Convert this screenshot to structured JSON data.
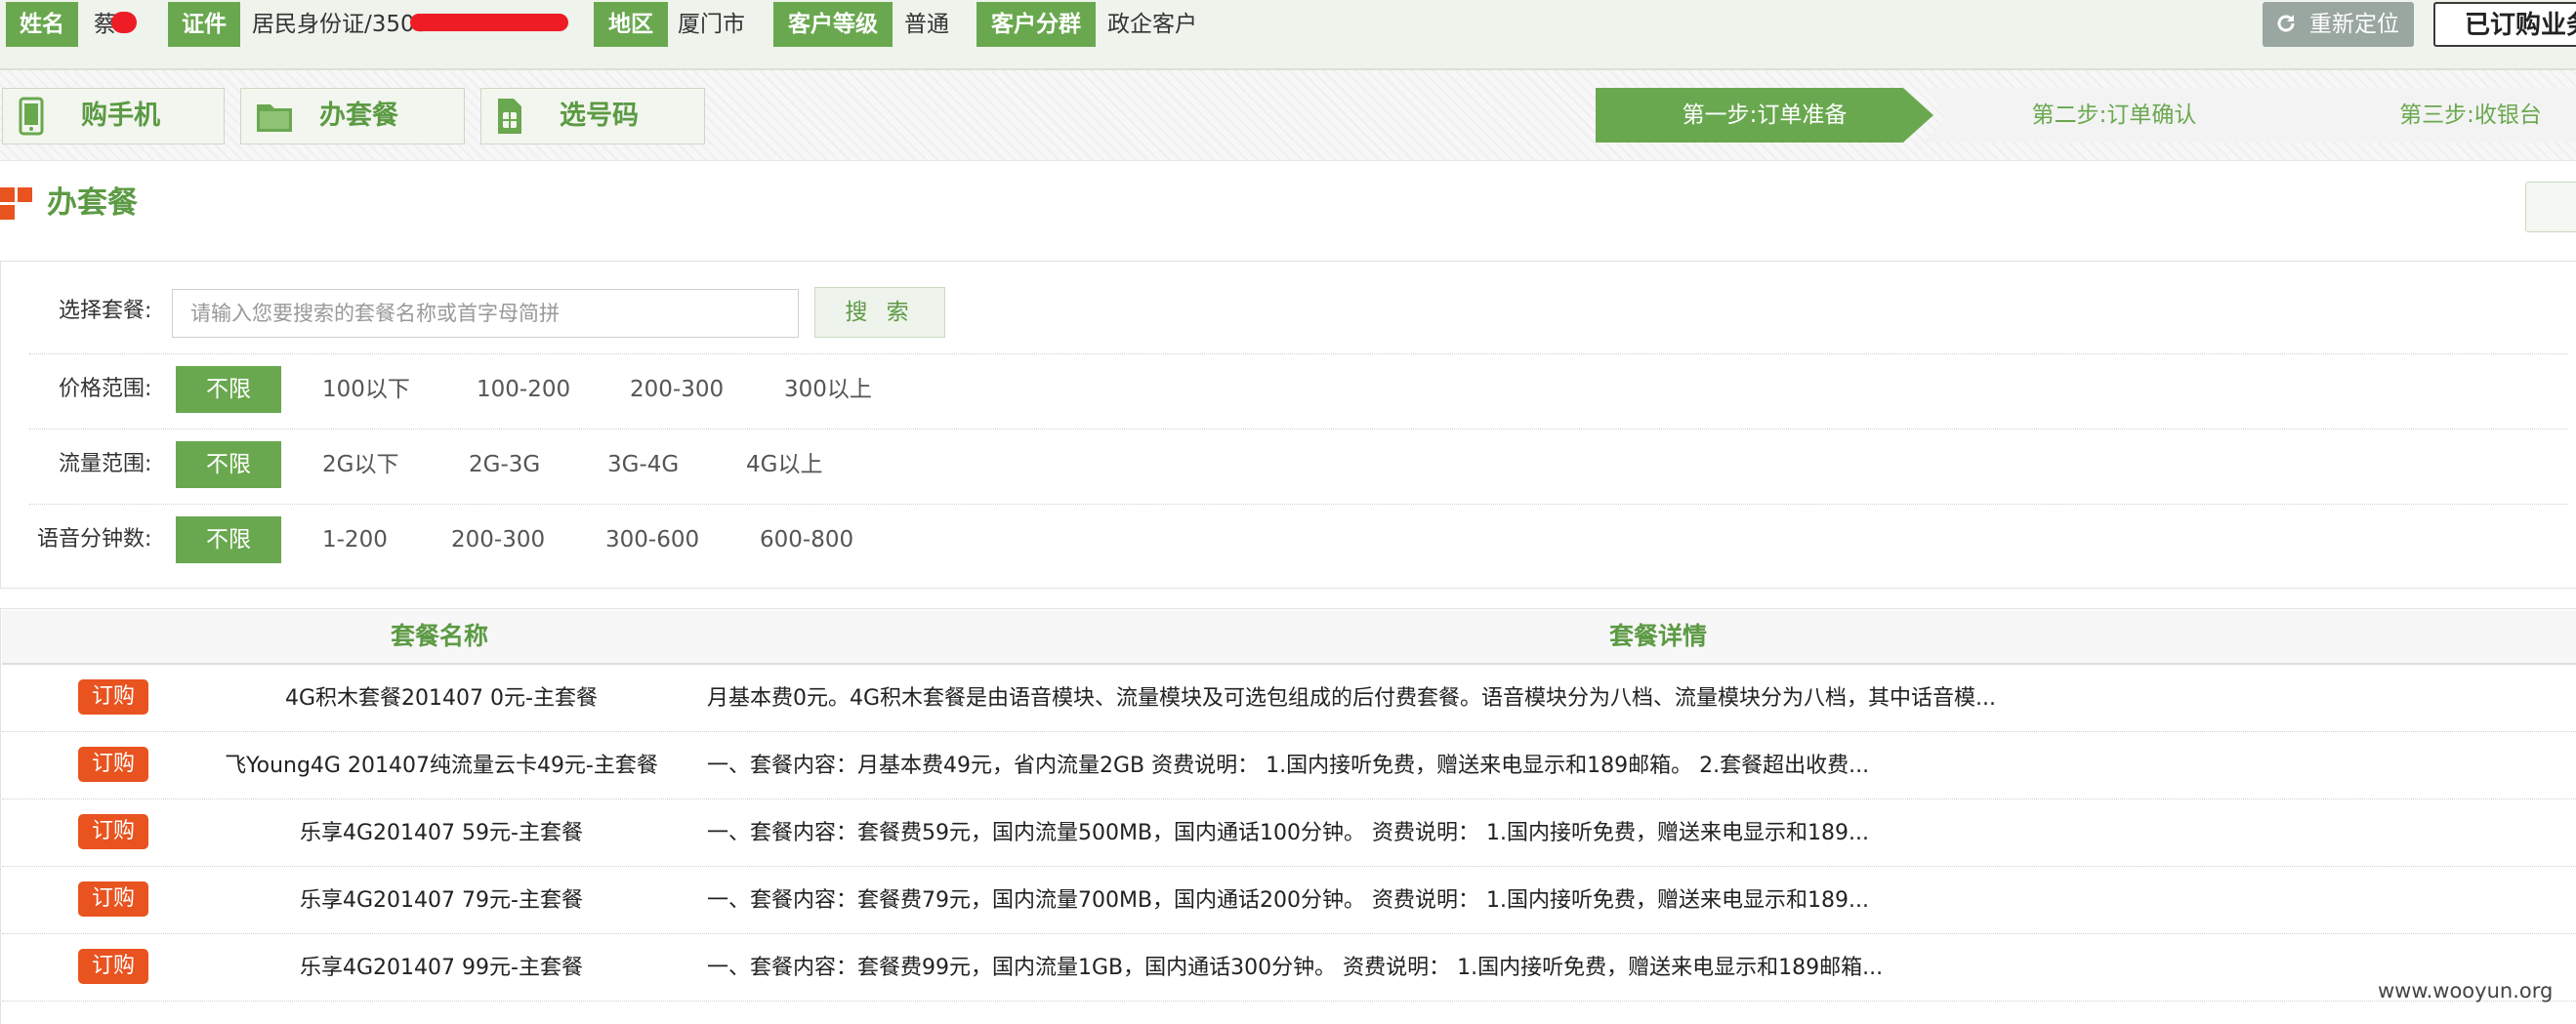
{
  "customer_bar": {
    "name_label": "姓名",
    "name_value": "蔡",
    "id_label": "证件",
    "id_value": "居民身份证/3503",
    "region_label": "地区",
    "region_value": "厦门市",
    "level_label": "客户等级",
    "level_value": "普通",
    "group_label": "客户分群",
    "group_value": "政企客户",
    "relocate_button": "重新定位",
    "subscribed_button": "已订购业务"
  },
  "nav": {
    "buy_phone": "购手机",
    "plan": "办套餐",
    "pick_number": "选号码"
  },
  "steps": [
    "第一步:订单准备",
    "第二步:订单确认",
    "第三步:收银台"
  ],
  "section_title": "办套餐",
  "filters": {
    "select_plan_label": "选择套餐:",
    "search_placeholder": "请输入您要搜索的套餐名称或首字母简拼",
    "search_button": "搜 索",
    "price": {
      "label": "价格范围:",
      "options": [
        "不限",
        "100以下",
        "100-200",
        "200-300",
        "300以上"
      ]
    },
    "data": {
      "label": "流量范围:",
      "options": [
        "不限",
        "2G以下",
        "2G-3G",
        "3G-4G",
        "4G以上"
      ]
    },
    "voice": {
      "label": "语音分钟数:",
      "options": [
        "不限",
        "1-200",
        "200-300",
        "300-600",
        "600-800"
      ]
    }
  },
  "table": {
    "headers": [
      "套餐名称",
      "套餐详情"
    ],
    "order_label": "订购",
    "rows": [
      {
        "name": "4G积木套餐201407 0元-主套餐",
        "detail": "月基本费0元。4G积木套餐是由语音模块、流量模块及可选包组成的后付费套餐。语音模块分为八档、流量模块分为八档，其中话音模..."
      },
      {
        "name": "飞Young4G 201407纯流量云卡49元-主套餐",
        "detail": "一、套餐内容：月基本费49元，省内流量2GB 资费说明： 1.国内接听免费，赠送来电显示和189邮箱。 2.套餐超出收费..."
      },
      {
        "name": "乐享4G201407 59元-主套餐",
        "detail": "一、套餐内容：套餐费59元，国内流量500MB，国内通话100分钟。 资费说明： 1.国内接听免费，赠送来电显示和189..."
      },
      {
        "name": "乐享4G201407 79元-主套餐",
        "detail": "一、套餐内容：套餐费79元，国内流量700MB，国内通话200分钟。 资费说明： 1.国内接听免费，赠送来电显示和189..."
      },
      {
        "name": "乐享4G201407 99元-主套餐",
        "detail": "一、套餐内容：套餐费99元，国内流量1GB，国内通话300分钟。 资费说明： 1.国内接听免费，赠送来电显示和189邮箱..."
      }
    ]
  },
  "watermark": "www.wooyun.org",
  "colors": {
    "accent_green": "#6aa84f",
    "order_orange": "#e8531f"
  }
}
